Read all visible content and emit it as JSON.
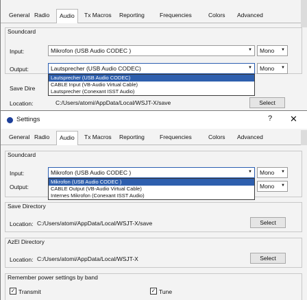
{
  "tabs": [
    "General",
    "Radio",
    "Audio",
    "Tx Macros",
    "Reporting",
    "Frequencies",
    "Colors",
    "Advanced"
  ],
  "active_tab": "Audio",
  "window": {
    "title": "Settings",
    "help": "?",
    "close": "✕"
  },
  "soundcard": {
    "label": "Soundcard",
    "input_label": "Input:",
    "input_value": "Mikrofon (USB Audio CODEC )",
    "input_channel": "Mono",
    "output_label": "Output:",
    "output_value": "Lautsprecher (USB Audio CODEC)",
    "output_channel": "Mono"
  },
  "output_dropdown": {
    "items": [
      "Lautsprecher (USB Audio CODEC)",
      "CABLE Input (VB-Audio Virtual Cable)",
      "Lautsprecher (Conexant ISST Audio)"
    ],
    "selected_index": 0
  },
  "input_dropdown": {
    "items": [
      "Mikrofon (USB Audio CODEC )",
      "CABLE Output (VB-Audio Virtual Cable)",
      "Internes Mikrofon (Conexant ISST Audio)"
    ],
    "selected_index": 0
  },
  "save_directory": {
    "label": "Save Directory",
    "label_truncated": "Save Dire",
    "location_label": "Location:",
    "path": "C:/Users/atomi/AppData/Local/WSJT-X/save",
    "select_label": "Select"
  },
  "azel_directory": {
    "label": "AzEl Directory",
    "location_label": "Location:",
    "path": "C:/Users/atomi/AppData/Local/WSJT-X",
    "select_label": "Select"
  },
  "power": {
    "label": "Remember power settings by band",
    "transmit_label": "Transmit",
    "tune_label": "Tune",
    "transmit_checked": true,
    "tune_checked": true
  },
  "glyphs": {
    "arrow": "▼",
    "check": "✓"
  }
}
